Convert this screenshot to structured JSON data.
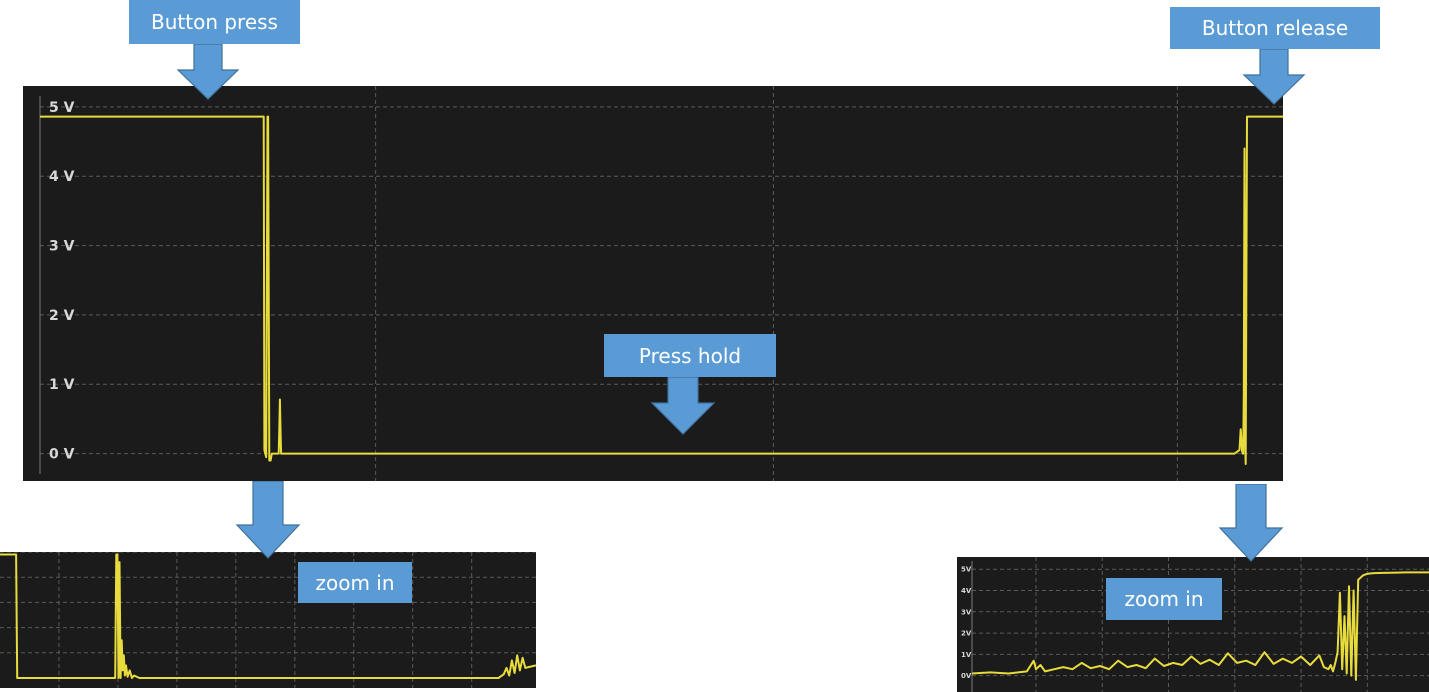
{
  "callouts": {
    "button_press": "Button press",
    "button_release": "Button release",
    "press_hold": "Press hold",
    "zoom_in_left": "zoom in",
    "zoom_in_right": "zoom in"
  },
  "colors": {
    "background": "#1b1b1b",
    "trace": "#e8dc3c",
    "grid": "#5a5a5a",
    "axis_text": "#d8d8d8",
    "callout": "#5b9bd5",
    "callout_text": "#ffffff"
  },
  "chart_data": [
    {
      "type": "line",
      "title": "",
      "xlabel": "",
      "ylabel": "",
      "ylim": [
        -0.15,
        5.1
      ],
      "xlim": [
        0,
        100
      ],
      "y_ticks": [
        "0 V",
        "1 V",
        "2 V",
        "3 V",
        "4 V",
        "5 V"
      ],
      "y_tick_values": [
        0,
        1,
        2,
        3,
        4,
        5
      ],
      "x_grid_values": [
        27,
        59,
        91.5
      ],
      "grid": true,
      "series": [
        {
          "x": [
            0,
            17.5,
            17.7,
            17.75,
            18.0,
            18.05,
            18.2,
            18.3,
            18.35,
            18.45,
            18.55,
            18.65,
            18.8,
            19.2,
            19.25,
            19.3,
            19.35,
            19.4,
            19.5,
            30,
            50,
            70,
            90,
            95,
            96.1,
            96.5,
            96.6,
            96.7,
            96.75,
            96.8,
            96.85,
            96.9,
            96.95,
            97.0,
            97.1,
            97.2,
            100
          ],
          "y": [
            4.86,
            4.86,
            4.86,
            4.86,
            4.86,
            0.05,
            -0.05,
            4.86,
            4.86,
            -0.1,
            -0.1,
            0.0,
            0.0,
            0.0,
            0.35,
            0.78,
            0.35,
            0.0,
            0.0,
            0.0,
            0.0,
            0.0,
            0.0,
            0.0,
            0.0,
            0.05,
            0.35,
            0.05,
            0.0,
            0.0,
            0.85,
            4.4,
            0.2,
            -0.15,
            4.86,
            4.86,
            4.86
          ]
        }
      ]
    },
    {
      "type": "line",
      "title": "",
      "xlabel": "",
      "ylabel": "",
      "xlim": [
        0,
        100
      ],
      "ylim": [
        0,
        5
      ],
      "x_grid_values": [
        11,
        22,
        33,
        44,
        55,
        66,
        77,
        88
      ],
      "y_grid_values": [
        1,
        2,
        3,
        4,
        5
      ],
      "grid": true,
      "series": [
        {
          "x": [
            0,
            3.0,
            3.2,
            3.4,
            10,
            21.5,
            21.7,
            21.9,
            22.1,
            22.3,
            22.5,
            22.7,
            22.9,
            23.1,
            23.3,
            23.5,
            23.8,
            24.2,
            24.6,
            25.0,
            26,
            40,
            60,
            80,
            93,
            94,
            94.5,
            95,
            95.5,
            96,
            96.5,
            97,
            97.5,
            98,
            100
          ],
          "y": [
            4.9,
            4.9,
            0.0,
            0.0,
            0.0,
            0.0,
            4.9,
            4.9,
            0.0,
            4.6,
            0.0,
            1.5,
            0.3,
            0.9,
            0.1,
            0.5,
            0.05,
            0.3,
            0.0,
            0.1,
            0.0,
            0.0,
            0.0,
            0.0,
            0.0,
            0.15,
            0.4,
            0.1,
            0.7,
            0.2,
            0.9,
            0.3,
            0.8,
            0.4,
            0.5
          ]
        }
      ]
    },
    {
      "type": "line",
      "title": "",
      "xlabel": "",
      "ylabel": "",
      "xlim": [
        0,
        100
      ],
      "ylim": [
        -0.3,
        5.2
      ],
      "y_ticks": [
        "0V",
        "1V",
        "2V",
        "3V",
        "4V",
        "5V"
      ],
      "y_tick_values": [
        0,
        1,
        2,
        3,
        4,
        5
      ],
      "x_grid_values": [
        14,
        28.5,
        43,
        57.5,
        72,
        86.5
      ],
      "grid": true,
      "series": [
        {
          "x": [
            0,
            4,
            8,
            12,
            13.5,
            14,
            15,
            16,
            18,
            20,
            22,
            24,
            26,
            28,
            30,
            32,
            34,
            36,
            38,
            40,
            42,
            44,
            46,
            48,
            50,
            52,
            54,
            56,
            58,
            60,
            62,
            64,
            66,
            68,
            70,
            72,
            74,
            76,
            77,
            78,
            78.5,
            79,
            79.5,
            80,
            80.5,
            81,
            81.5,
            82,
            82.5,
            83,
            83.5,
            84,
            84.5,
            85,
            85.5,
            86,
            86.5,
            87,
            88,
            90,
            95,
            100
          ],
          "y": [
            0.1,
            0.15,
            0.1,
            0.2,
            0.7,
            0.3,
            0.5,
            0.2,
            0.3,
            0.4,
            0.3,
            0.6,
            0.35,
            0.45,
            0.3,
            0.7,
            0.4,
            0.5,
            0.35,
            0.8,
            0.45,
            0.6,
            0.5,
            0.9,
            0.55,
            0.75,
            0.5,
            1.05,
            0.6,
            0.7,
            0.5,
            1.1,
            0.55,
            0.8,
            0.6,
            0.9,
            0.5,
            0.95,
            0.4,
            0.3,
            0.5,
            0.2,
            0.6,
            1.1,
            3.9,
            0.3,
            2.8,
            0.1,
            4.2,
            0.0,
            4.0,
            -0.2,
            4.5,
            4.6,
            4.7,
            4.75,
            4.78,
            4.8,
            4.82,
            4.83,
            4.85,
            4.85
          ]
        }
      ]
    }
  ]
}
